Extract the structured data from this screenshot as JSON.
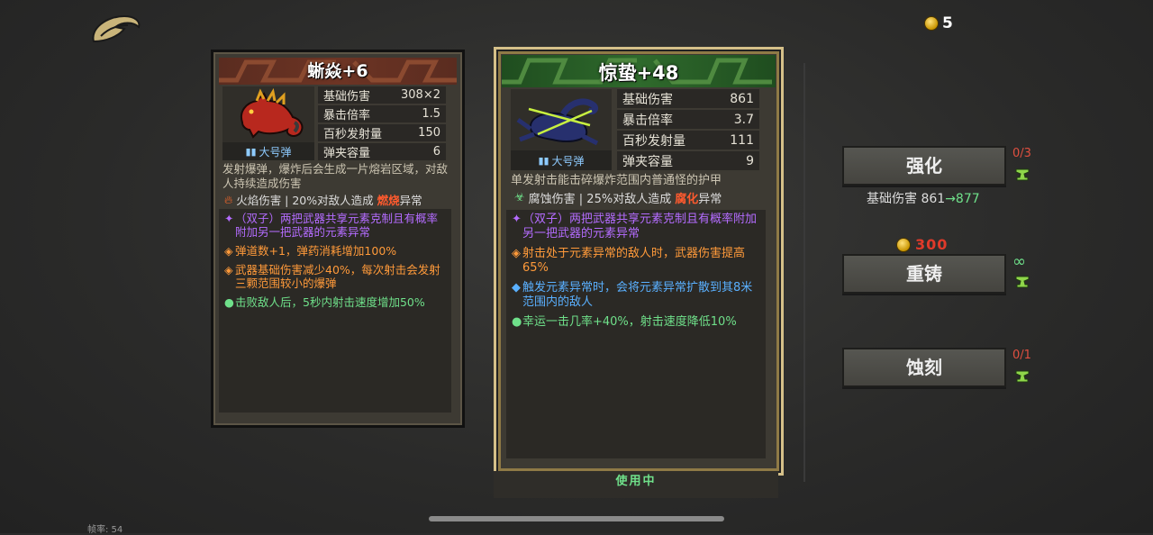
{
  "header": {
    "coin_count": "5"
  },
  "left_card": {
    "title": "蜥焱+6",
    "ammo_label": "大号弹",
    "stats": [
      {
        "label": "基础伤害",
        "value": "308×2"
      },
      {
        "label": "暴击倍率",
        "value": "1.5"
      },
      {
        "label": "百秒发射量",
        "value": "150"
      },
      {
        "label": "弹夹容量",
        "value": "6"
      }
    ],
    "description": "发射爆弹，爆炸后会生成一片熔岩区域，对敌人持续造成伤害",
    "element_prefix": "火焰伤害 | 20%对敌人造成",
    "element_name": "燃烧",
    "element_suffix": "异常",
    "traits": [
      {
        "color": "purple",
        "text": "（双子）两把武器共享元素克制且有概率附加另一把武器的元素异常"
      },
      {
        "color": "orange",
        "text": "弹道数+1，弹药消耗增加100%"
      },
      {
        "color": "orange",
        "text": "武器基础伤害减少40%，每次射击会发射三颗范围较小的爆弹"
      },
      {
        "color": "green",
        "text": "击败敌人后，5秒内射击速度增加50%"
      }
    ]
  },
  "right_card": {
    "title": "惊蛰+48",
    "ammo_label": "大号弹",
    "stats": [
      {
        "label": "基础伤害",
        "value": "861"
      },
      {
        "label": "暴击倍率",
        "value": "3.7"
      },
      {
        "label": "百秒发射量",
        "value": "111"
      },
      {
        "label": "弹夹容量",
        "value": "9"
      }
    ],
    "description": "单发射击能击碎爆炸范围内普通怪的护甲",
    "element_prefix": "腐蚀伤害 | 25%对敌人造成",
    "element_name": "腐化",
    "element_suffix": "异常",
    "traits": [
      {
        "color": "purple",
        "text": "（双子）两把武器共享元素克制且有概率附加另一把武器的元素异常"
      },
      {
        "color": "orange",
        "text": "射击处于元素异常的敌人时，武器伤害提高65%"
      },
      {
        "color": "blue",
        "text": "触发元素异常时，会将元素异常扩散到其8米范围内的敌人"
      },
      {
        "color": "green",
        "text": "幸运一击几率+40%，射击速度降低10%"
      }
    ],
    "status": "使用中"
  },
  "actions": {
    "upgrade": {
      "label": "强化",
      "count": "0/3",
      "stat_label": "基础伤害",
      "stat_old": "861",
      "stat_arrow": "→",
      "stat_new": "877"
    },
    "reforge": {
      "label": "重铸",
      "cost": "300",
      "count": "∞"
    },
    "engrave": {
      "label": "蚀刻",
      "count": "0/1"
    }
  },
  "footer": {
    "fps": "帧率: 54"
  },
  "colors": {
    "gold": "#d5c089",
    "green": "#6fe08a",
    "red": "#e05040",
    "purple": "#b46cff",
    "orange": "#ff9a3a",
    "blue": "#5ab0ff"
  },
  "icons": [
    "back-icon",
    "coin-icon",
    "ammo-icon",
    "fire-icon",
    "corrosion-icon",
    "anvil-icon"
  ]
}
